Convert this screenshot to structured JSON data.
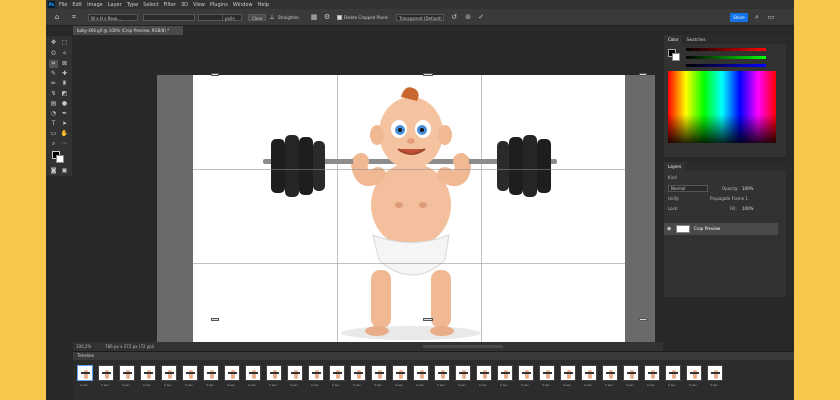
{
  "menubar": {
    "logo": "Ps",
    "items": [
      "File",
      "Edit",
      "Image",
      "Layer",
      "Type",
      "Select",
      "Filter",
      "3D",
      "View",
      "Plugins",
      "Window",
      "Help"
    ]
  },
  "options": {
    "ratio": "W x H x Reso...",
    "resolution": "px/in",
    "clear": "Clear",
    "straighten": "Straighten",
    "delete_cropped": "Delete Cropped Pixels",
    "fill": "Transparent (Default)",
    "share": "Share"
  },
  "document": {
    "tab": "baby-466.gif @ 100% (Crop Preview, RGB/8) *",
    "zoom": "100.2%",
    "size": "786 px x 272 px (72 ppi)"
  },
  "color_panel": {
    "tabs": [
      "Color",
      "Swatches"
    ]
  },
  "layers_panel": {
    "tabs": [
      "Layers"
    ],
    "kind": "Kind",
    "blend": "Normal",
    "opacity_label": "Opacity:",
    "opacity": "100%",
    "lock_label": "Lock:",
    "fill_label": "Fill:",
    "fill": "100%",
    "propagate": "Propagate Frame 1",
    "unify": "Unify:",
    "layer_name": "Crop Preview"
  },
  "timeline": {
    "title": "Timeline",
    "frame_count": 31,
    "delay": "0 sec"
  },
  "icons": [
    "home-icon",
    "crop-icon",
    "undo-icon",
    "reset-icon",
    "commit-icon",
    "search-icon",
    "gear-icon"
  ]
}
